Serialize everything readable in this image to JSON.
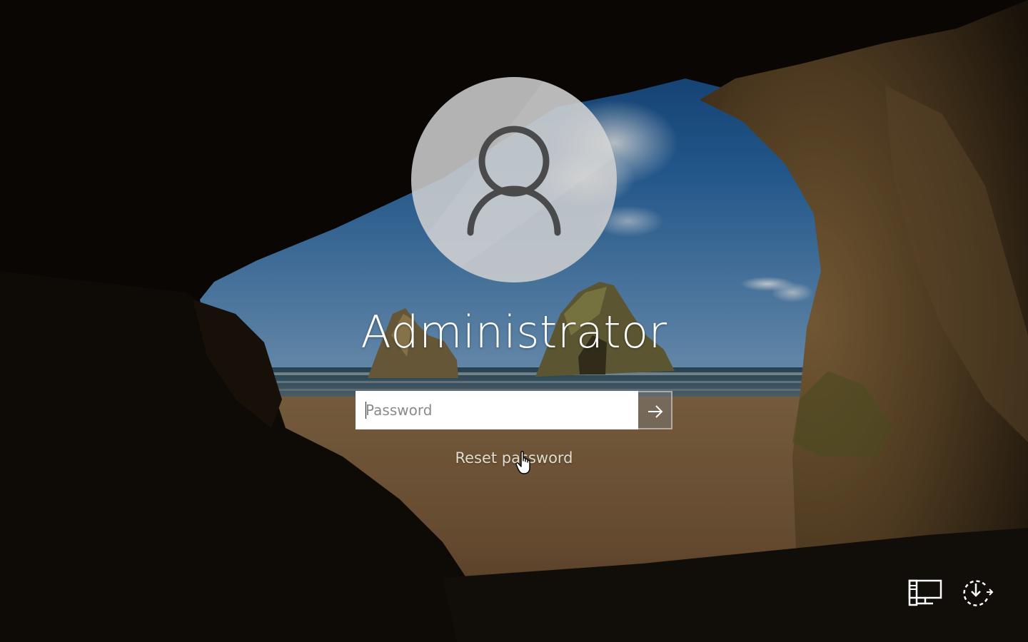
{
  "login": {
    "username": "Administrator",
    "password_placeholder": "Password",
    "password_value": "",
    "submit_icon": "arrow-right-icon",
    "reset_link": "Reset password",
    "avatar_icon": "user-icon"
  },
  "corner_controls": {
    "network_icon": "network-icon",
    "power_icon": "power-icon"
  },
  "colors": {
    "accent": "#ffffff",
    "avatar_bg": "#d0d0d0",
    "icon_stroke": "#4a4a4a"
  }
}
